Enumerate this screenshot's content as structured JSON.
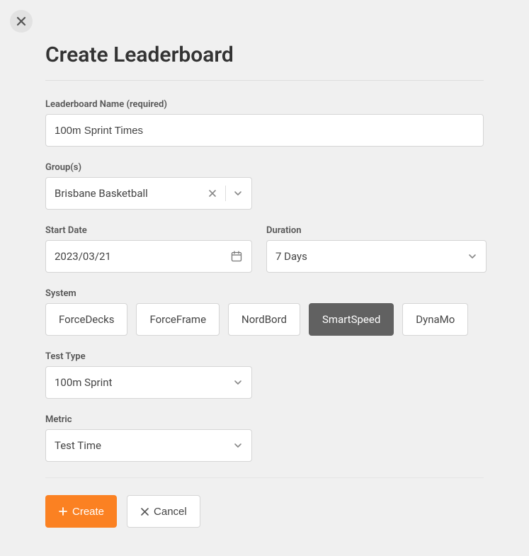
{
  "title": "Create Leaderboard",
  "fields": {
    "name": {
      "label": "Leaderboard Name (required)",
      "value": "100m Sprint Times"
    },
    "groups": {
      "label": "Group(s)",
      "value": "Brisbane Basketball"
    },
    "start_date": {
      "label": "Start Date",
      "value": "2023/03/21"
    },
    "duration": {
      "label": "Duration",
      "value": "7 Days"
    },
    "system": {
      "label": "System",
      "options": [
        "ForceDecks",
        "ForceFrame",
        "NordBord",
        "SmartSpeed",
        "DynaMo"
      ],
      "selected": "SmartSpeed"
    },
    "test_type": {
      "label": "Test Type",
      "value": "100m Sprint"
    },
    "metric": {
      "label": "Metric",
      "value": "Test Time"
    }
  },
  "actions": {
    "create": "Create",
    "cancel": "Cancel"
  }
}
